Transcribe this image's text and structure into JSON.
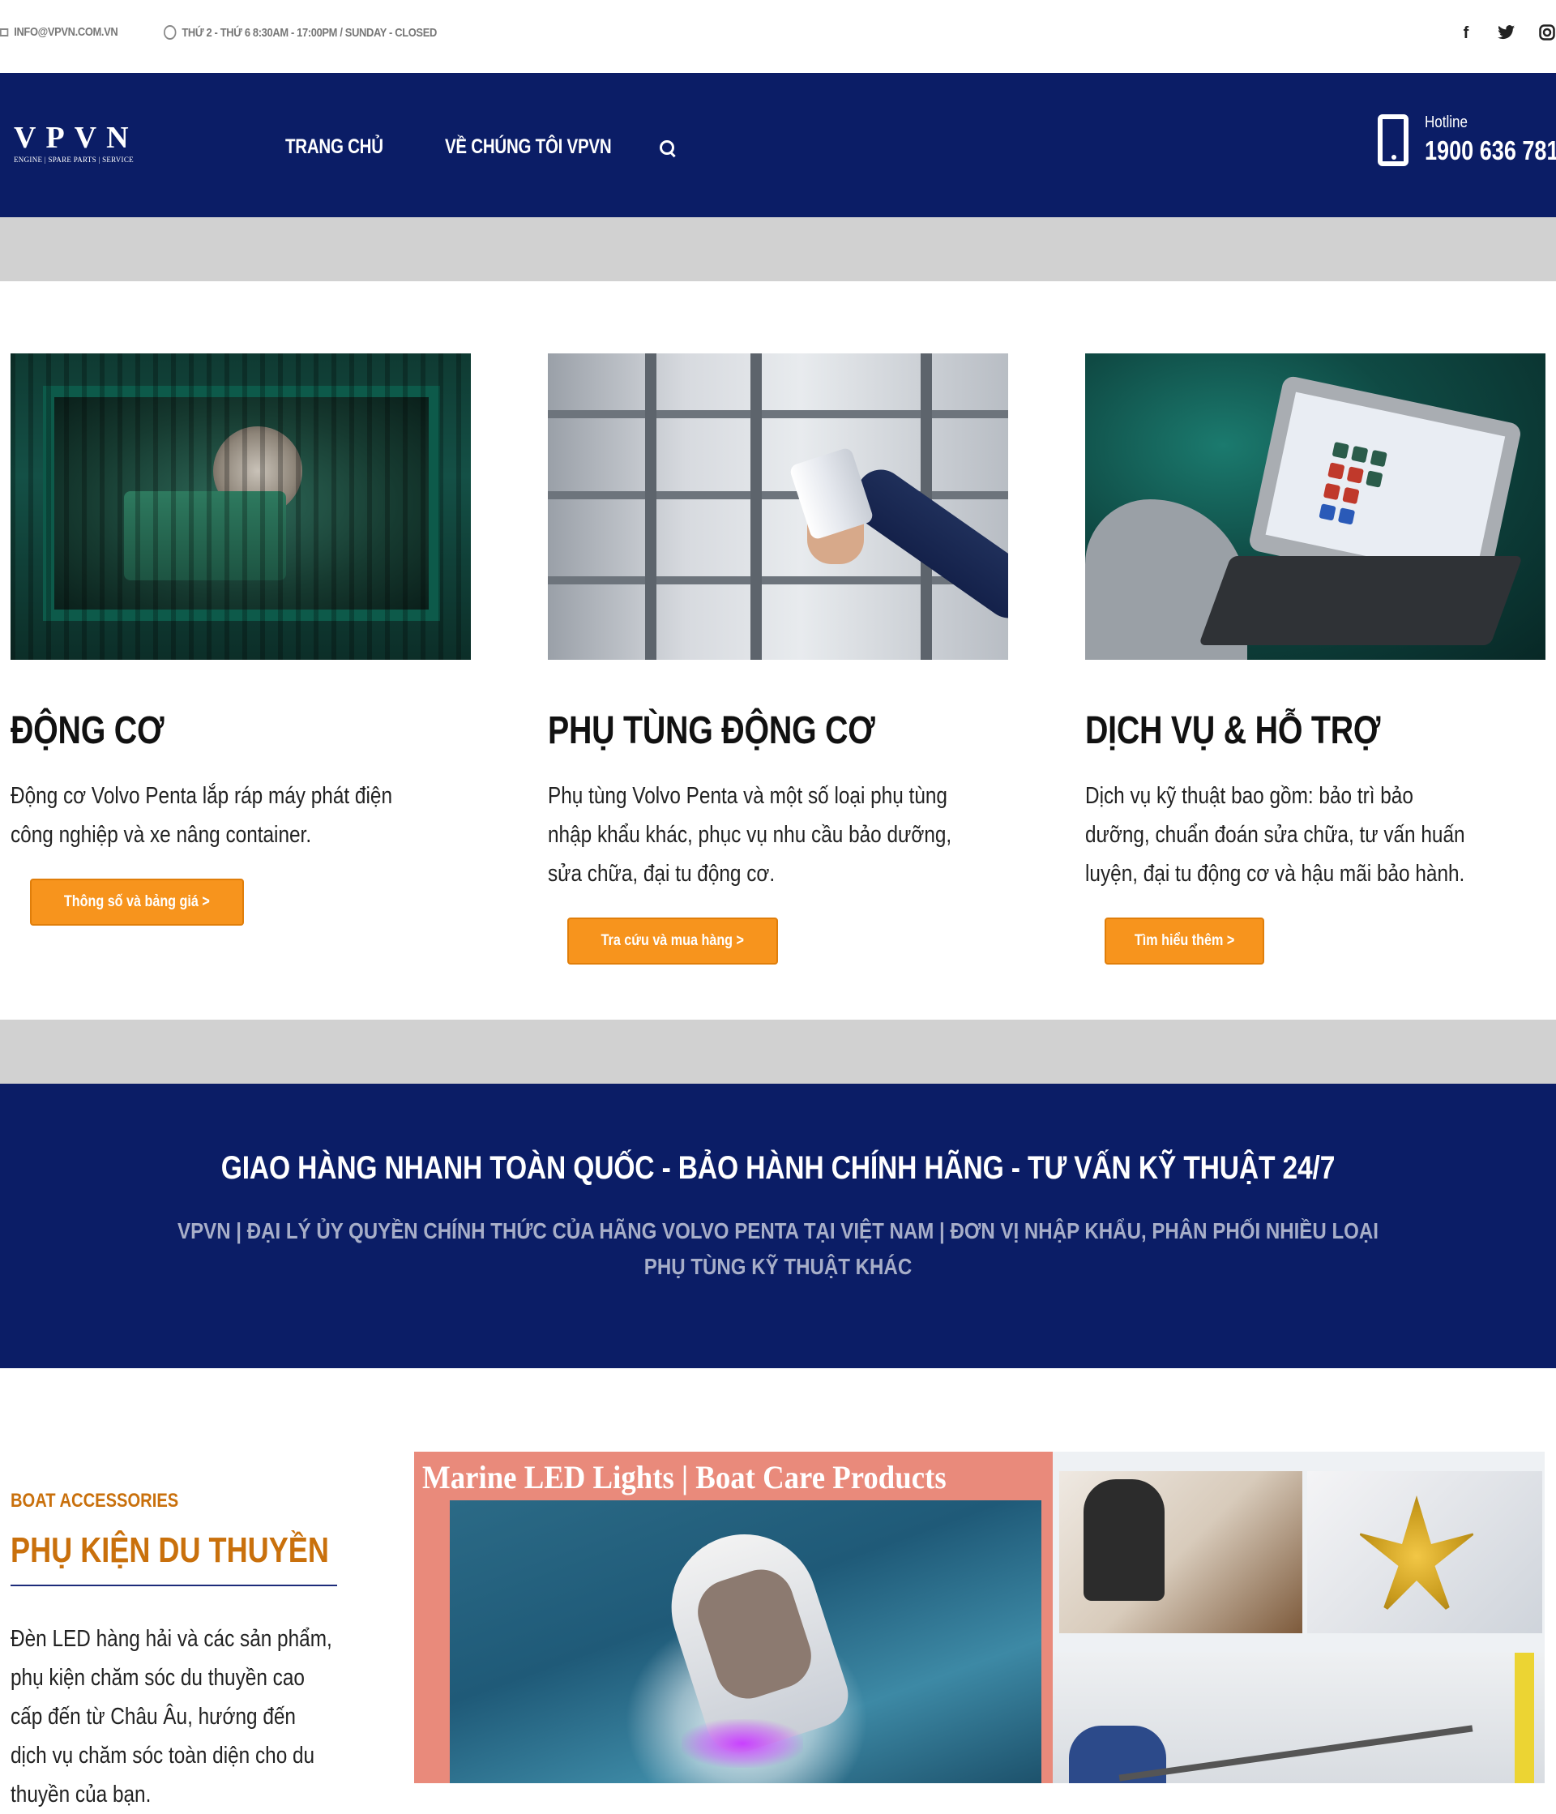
{
  "topbar": {
    "email": "INFO@VPVN.COM.VN",
    "hours": "THỨ 2 - THỨ 6 8:30AM - 17:00PM / SUNDAY - CLOSED",
    "social": [
      "f",
      "t",
      "o"
    ]
  },
  "header": {
    "logo_main": "VPVN",
    "logo_sub": "ENGINE | SPARE PARTS | SERVICE",
    "nav": [
      "TRANG CHỦ",
      "VỀ CHÚNG TÔI VPVN"
    ],
    "hotline_label": "Hotline",
    "hotline_number": "1900 636 781"
  },
  "cards": [
    {
      "title": "ĐỘNG CƠ",
      "text": "Động cơ Volvo Penta lắp ráp máy phát điện công nghiệp và xe nâng container.",
      "button": "Thông số và bảng giá >"
    },
    {
      "title": "PHỤ TÙNG ĐỘNG CƠ",
      "text": "Phụ tùng Volvo Penta và một số loại phụ tùng nhập khẩu khác, phục vụ nhu cầu bảo dưỡng, sửa chữa, đại tu động cơ.",
      "button": "Tra cứu và mua hàng >"
    },
    {
      "title": "DỊCH VỤ & HỖ TRỢ",
      "text": "Dịch vụ kỹ thuật bao gồm: bảo trì bảo dưỡng, chuẩn đoán sửa chữa, tư vấn huấn luyện, đại tu động cơ và hậu mãi bảo hành.",
      "button": "Tìm hiểu thêm >"
    }
  ],
  "banner": {
    "title": "GIAO HÀNG NHANH TOÀN QUỐC - BẢO HÀNH CHÍNH HÃNG - TƯ VẤN KỸ THUẬT 24/7",
    "subtitle": "VPVN | ĐẠI LÝ ỦY QUYỀN CHÍNH THỨC CỦA HÃNG VOLVO PENTA TẠI VIỆT NAM | ĐƠN VỊ NHẬP KHẨU, PHÂN PHỐI NHIỀU LOẠI PHỤ TÙNG KỸ THUẬT KHÁC"
  },
  "accessories": {
    "label": "BOAT ACCESSORIES",
    "title": "PHỤ KIỆN DU THUYỀN",
    "text": "Đèn LED hàng hải và các sản phẩm, phụ kiện chăm sóc du thuyền cao cấp đến từ Châu Âu, hướng đến dịch vụ chăm sóc toàn diện cho du thuyền của bạn.",
    "image_caption": "Marine LED Lights | Boat Care Products"
  },
  "colors": {
    "navy": "#0b1d66",
    "accent_orange": "#f7941d",
    "accessory_orange": "#c9700c",
    "gray_band": "#d1d1d1"
  }
}
